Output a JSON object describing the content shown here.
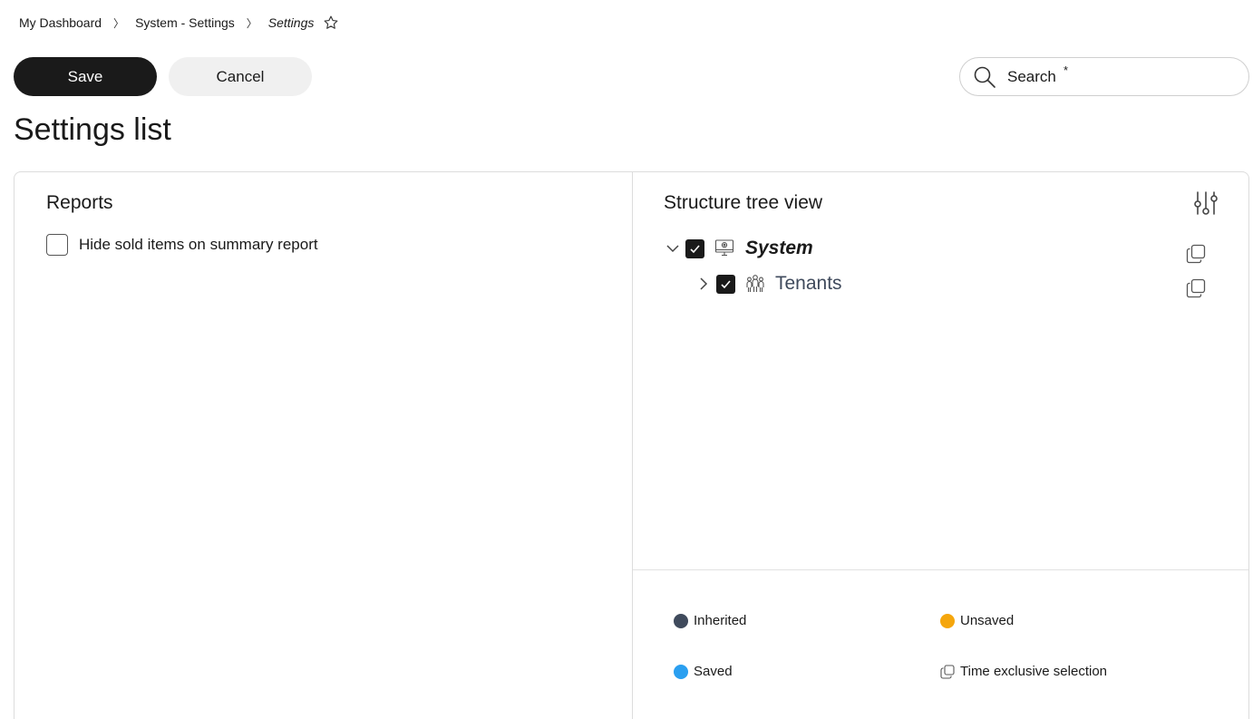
{
  "breadcrumb": {
    "items": [
      "My Dashboard",
      "System - Settings",
      "Settings"
    ],
    "separator": "〉"
  },
  "toolbar": {
    "save_label": "Save",
    "cancel_label": "Cancel"
  },
  "search": {
    "placeholder": "Search",
    "required_marker": "*"
  },
  "page": {
    "title": "Settings list"
  },
  "reports": {
    "title": "Reports",
    "options": [
      {
        "label": "Hide sold items on summary report",
        "checked": false
      }
    ]
  },
  "tree": {
    "title": "Structure tree view",
    "nodes": [
      {
        "label": "System",
        "checked": true,
        "expanded": true,
        "icon": "system-monitor-icon"
      },
      {
        "label": "Tenants",
        "checked": true,
        "expanded": false,
        "icon": "people-group-icon"
      }
    ]
  },
  "legend": {
    "inherited": {
      "label": "Inherited",
      "color": "#3f4a5c"
    },
    "unsaved": {
      "label": "Unsaved",
      "color": "#f5a60c"
    },
    "saved": {
      "label": "Saved",
      "color": "#2a9ff0"
    },
    "time_exclusive": {
      "label": "Time exclusive selection",
      "icon": "copy-icon"
    }
  },
  "colors": {
    "primary": "#1a1a1a",
    "secondary_button": "#f0f0f0",
    "border": "#dcdcdc"
  }
}
